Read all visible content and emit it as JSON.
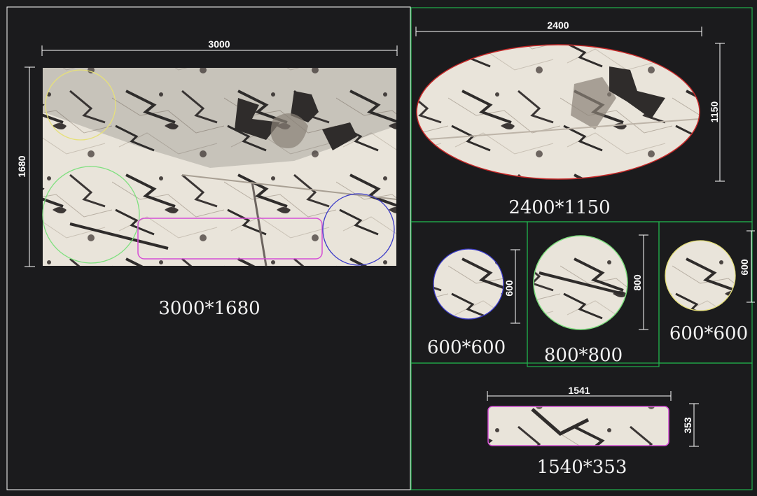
{
  "colors": {
    "background": "#1b1b1d",
    "dimension_line": "#ffffff",
    "frame_main": "#ffffff",
    "frame_group": "#22b14c",
    "outline_yellow": "#e6e07a",
    "outline_green": "#7ee07e",
    "outline_magenta": "#d64fd6",
    "outline_blue": "#3a3ac8",
    "outline_red": "#c82828",
    "marble_base": "#e9e4da",
    "vein_dark": "#2f2c2b"
  },
  "slab": {
    "dim_width": "3000",
    "dim_height": "1680",
    "caption": "3000*1680"
  },
  "oval": {
    "dim_width": "2400",
    "dim_height": "1150",
    "caption": "2400*1150"
  },
  "circle_small_blue": {
    "dim": "600",
    "caption": "600*600"
  },
  "circle_large_green": {
    "dim": "800",
    "caption": "800*800"
  },
  "circle_small_yellow": {
    "dim": "600",
    "caption": "600*600"
  },
  "strip": {
    "dim_width": "1541",
    "dim_height": "353",
    "caption": "1540*353"
  }
}
